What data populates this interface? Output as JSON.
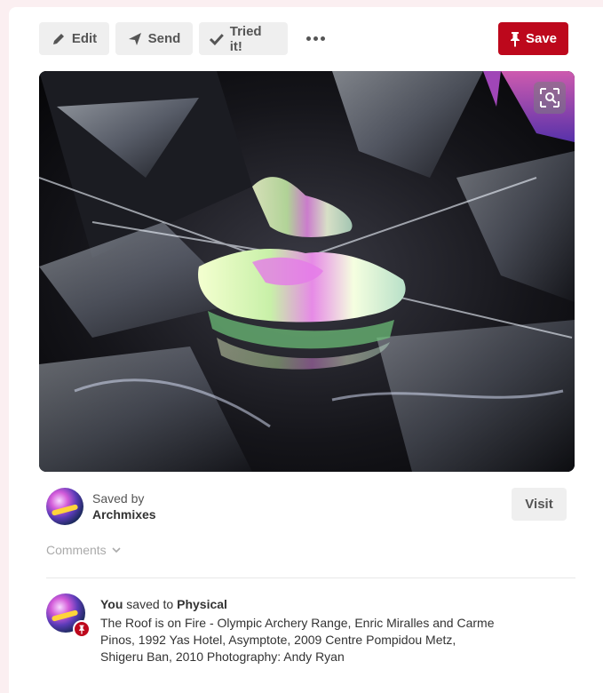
{
  "toolbar": {
    "edit_label": "Edit",
    "send_label": "Send",
    "tried_label": "Tried it!",
    "save_label": "Save"
  },
  "colors": {
    "save_red": "#bd081c",
    "button_gray": "#efefef"
  },
  "saver": {
    "label": "Saved by",
    "name": "Archmixes"
  },
  "visit_label": "Visit",
  "comments_label": "Comments",
  "activity": {
    "you": "You",
    "saved_to": "saved to",
    "board": "Physical",
    "description": "The Roof is on Fire - Olympic Archery Range, Enric Miralles and Carme Pinos, 1992 Yas Hotel, Asymptote, 2009 Centre Pompidou Metz, Shigeru Ban, 2010 Photography: Andy Ryan"
  },
  "icons": {
    "edit": "pencil-icon",
    "send": "paper-plane-icon",
    "tried": "checkmark-icon",
    "more": "ellipsis-icon",
    "save": "pushpin-icon",
    "lens": "visual-search-icon",
    "comments": "chevron-down-icon"
  }
}
